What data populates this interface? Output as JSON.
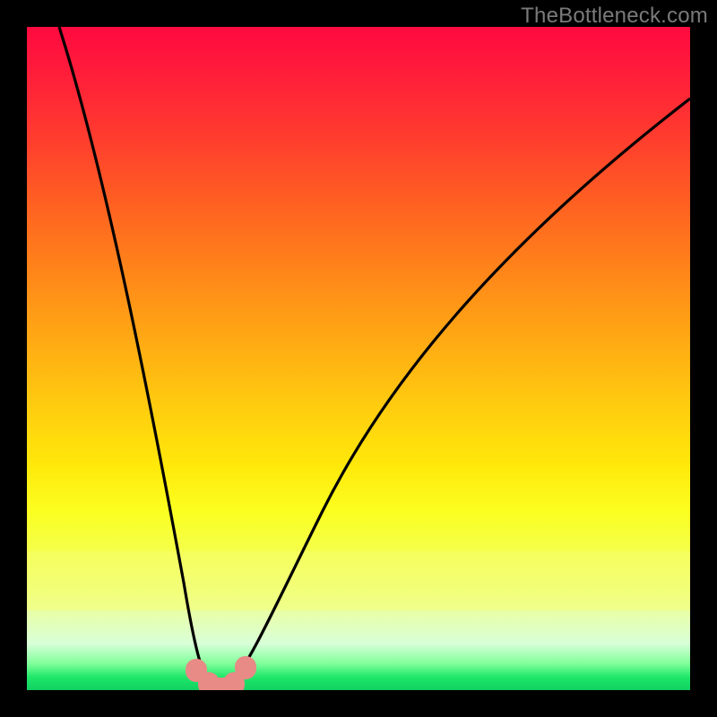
{
  "watermark": {
    "text": "TheBottleneck.com"
  },
  "chart_data": {
    "type": "line",
    "title": "",
    "xlabel": "",
    "ylabel": "",
    "xlim": [
      0,
      100
    ],
    "ylim": [
      0,
      100
    ],
    "grid": false,
    "legend": false,
    "background": {
      "kind": "vertical-gradient",
      "stops": [
        {
          "pct": 0,
          "color": "#ff0a3f"
        },
        {
          "pct": 50,
          "color": "#ffa514"
        },
        {
          "pct": 70,
          "color": "#fff020"
        },
        {
          "pct": 95,
          "color": "#c0ffd0"
        },
        {
          "pct": 100,
          "color": "#10d060"
        }
      ]
    },
    "series": [
      {
        "name": "bottleneck-curve",
        "color": "#000000",
        "x": [
          0,
          4,
          8,
          12,
          16,
          18,
          20,
          22,
          24,
          26,
          27,
          28,
          29,
          30,
          31,
          32,
          34,
          36,
          40,
          46,
          54,
          64,
          76,
          90,
          100
        ],
        "y": [
          100,
          84,
          68,
          52,
          36,
          28,
          20,
          12,
          6,
          2,
          0.5,
          0,
          0,
          0,
          0.5,
          2,
          6,
          12,
          22,
          36,
          52,
          66,
          78,
          86,
          90
        ]
      }
    ],
    "markers": [
      {
        "x": 25.5,
        "y": 3.0,
        "color": "#e88a86",
        "shape": "rounded"
      },
      {
        "x": 27.2,
        "y": 0.8,
        "color": "#e88a86",
        "shape": "rounded"
      },
      {
        "x": 29.0,
        "y": 0.4,
        "color": "#e88a86",
        "shape": "rounded-flat"
      },
      {
        "x": 31.0,
        "y": 0.8,
        "color": "#e88a86",
        "shape": "rounded"
      },
      {
        "x": 33.0,
        "y": 3.4,
        "color": "#e88a86",
        "shape": "rounded"
      }
    ],
    "notes": "V-shaped curve on heat gradient; minimum (optimal) near x≈29. Y values are percentage-of-plot-height estimates read off the figure."
  }
}
